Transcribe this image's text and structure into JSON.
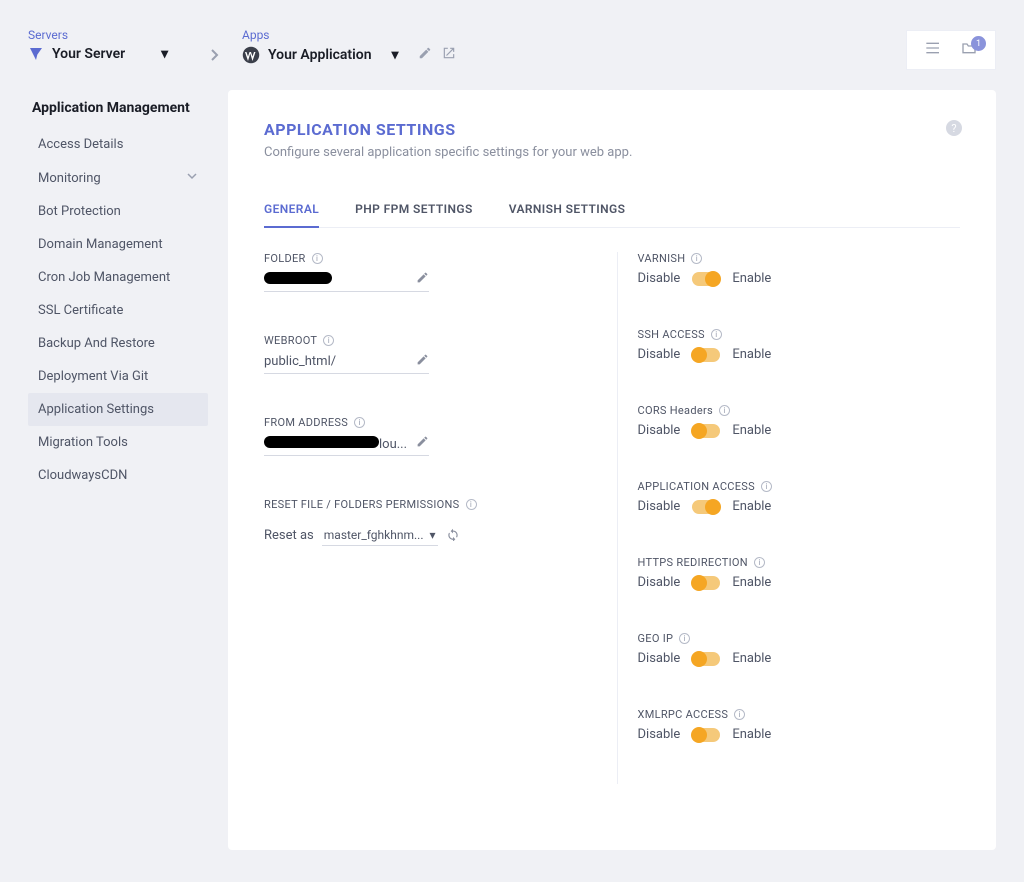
{
  "breadcrumb": {
    "servers_label": "Servers",
    "server_name": "Your Server",
    "apps_label": "Apps",
    "app_name": "Your Application"
  },
  "topright": {
    "badge_count": "1"
  },
  "sidebar": {
    "title": "Application Management",
    "items": [
      {
        "label": "Access Details"
      },
      {
        "label": "Monitoring",
        "expandable": true
      },
      {
        "label": "Bot Protection"
      },
      {
        "label": "Domain Management"
      },
      {
        "label": "Cron Job Management"
      },
      {
        "label": "SSL Certificate"
      },
      {
        "label": "Backup And Restore"
      },
      {
        "label": "Deployment Via Git"
      },
      {
        "label": "Application Settings",
        "active": true
      },
      {
        "label": "Migration Tools"
      },
      {
        "label": "CloudwaysCDN"
      }
    ]
  },
  "panel": {
    "title": "APPLICATION SETTINGS",
    "subtitle": "Configure several application specific settings for your web app.",
    "tabs": [
      {
        "label": "GENERAL",
        "active": true
      },
      {
        "label": "PHP FPM SETTINGS"
      },
      {
        "label": "VARNISH SETTINGS"
      }
    ]
  },
  "left": {
    "folder_label": "FOLDER",
    "folder_value": "██████████",
    "webroot_label": "WEBROOT",
    "webroot_value": "public_html/",
    "from_label": "FROM ADDRESS",
    "from_value_suffix": "lou...",
    "reset_label": "RESET FILE / FOLDERS PERMISSIONS",
    "reset_as": "Reset as",
    "reset_user": "master_fghkhnm..."
  },
  "right": {
    "disable": "Disable",
    "enable": "Enable",
    "toggles": [
      {
        "label": "VARNISH",
        "state": "on"
      },
      {
        "label": "SSH ACCESS",
        "state": "off"
      },
      {
        "label": "CORS Headers",
        "state": "off"
      },
      {
        "label": "APPLICATION ACCESS",
        "state": "on"
      },
      {
        "label": "HTTPS REDIRECTION",
        "state": "off"
      },
      {
        "label": "GEO IP",
        "state": "off"
      },
      {
        "label": "XMLRPC ACCESS",
        "state": "off"
      }
    ]
  }
}
